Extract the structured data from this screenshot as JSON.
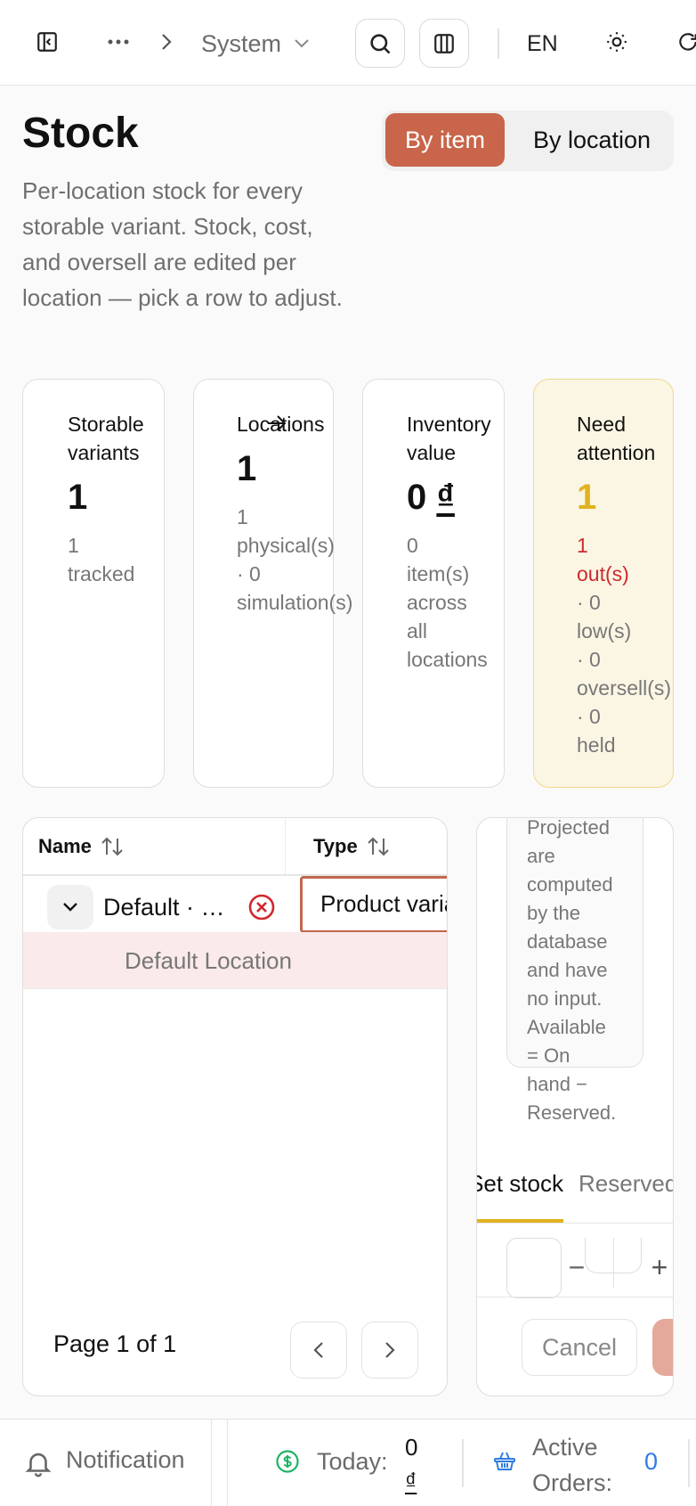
{
  "topbar": {
    "breadcrumb": "System",
    "language": "EN"
  },
  "header": {
    "title": "Stock",
    "description": "Per-location stock for every storable variant. Stock, cost, and oversell are edited per location — pick a row to adjust.",
    "view_toggle": {
      "by_item": "By item",
      "by_location": "By location",
      "active": "By item"
    }
  },
  "stats": {
    "storable": {
      "label_line1": "Storable",
      "label_line2": "variants",
      "value": "1",
      "sub_line1": "1",
      "sub_line2": "tracked"
    },
    "locations": {
      "label": "Locations",
      "value": "1",
      "sub_line1": "1",
      "sub_line2": "physical(s)",
      "sub_line3": "· 0",
      "sub_line4": "simulation(s)"
    },
    "inventory": {
      "label_line1": "Inventory",
      "label_line2": "value",
      "value": "0",
      "currency": "₫",
      "sub_line1": "0",
      "sub_line2": "item(s)",
      "sub_line3": "across",
      "sub_line4": "all",
      "sub_line5": "locations"
    },
    "attention": {
      "label_line1": "Need",
      "label_line2": "attention",
      "value": "1",
      "out_line1": "1",
      "out_line2": "out(s)",
      "sub_line1": "· 0",
      "sub_line2": "low(s)",
      "sub_line3": "· 0",
      "sub_line4": "oversell(s)",
      "sub_line5": "· 0",
      "sub_line6": "held"
    },
    "warn_color": "#e1b21f"
  },
  "table": {
    "columns": {
      "name": "Name",
      "type": "Type"
    },
    "row": {
      "name": "Default · Default",
      "type": "Product variant"
    },
    "sub_row": {
      "label": "Default Location"
    },
    "pagination": {
      "label": "Page 1 of 1"
    }
  },
  "editor": {
    "note_lines": [
      "Projected",
      "are",
      "computed",
      "by the",
      "database",
      "and have",
      "no input.",
      "Available",
      "= On",
      "hand −",
      "Reserved."
    ],
    "tabs": {
      "stock": "Set stock",
      "reserved": "Reserved"
    },
    "qty": {
      "minus": "−",
      "plus": "+"
    },
    "cancel": "Cancel"
  },
  "footer": {
    "notification": "Notification",
    "today_label": "Today:",
    "today_value": "0",
    "today_currency": "₫",
    "orders_label_line1": "Active",
    "orders_label_line2": "Orders:",
    "orders_value": "0"
  }
}
